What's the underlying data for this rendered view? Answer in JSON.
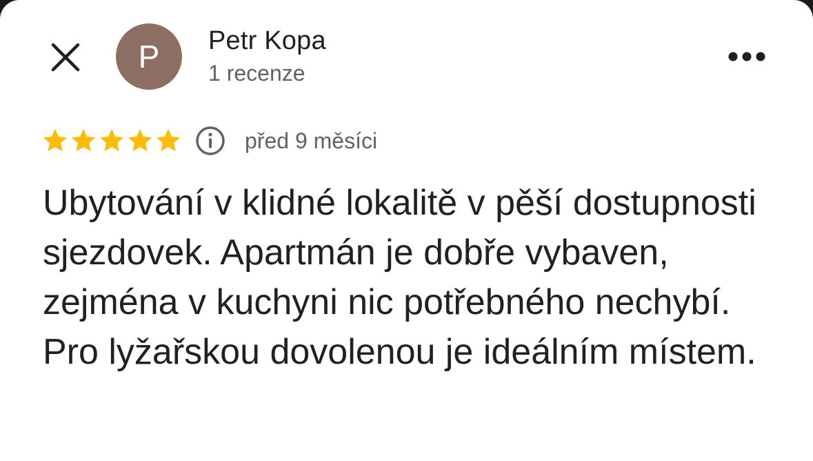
{
  "review": {
    "author": {
      "initial": "P",
      "name": "Petr Kopa",
      "review_count": "1 recenze",
      "avatar_color": "#8d6e63"
    },
    "rating": 5,
    "rating_max": 5,
    "star_color": "#fbbc04",
    "time_ago": "před 9 měsíci",
    "text": "Ubytování v klidné lokalitě v pěší dostupnosti sjezdovek. Apartmán je dobře vybaven, zejména v kuchyni nic potřebného nechybí. Pro lyžařskou dovolenou je ideálním místem."
  },
  "icons": {
    "close": "close-icon",
    "more": "more-horizontal-icon",
    "info": "info-icon",
    "star": "star-icon"
  }
}
